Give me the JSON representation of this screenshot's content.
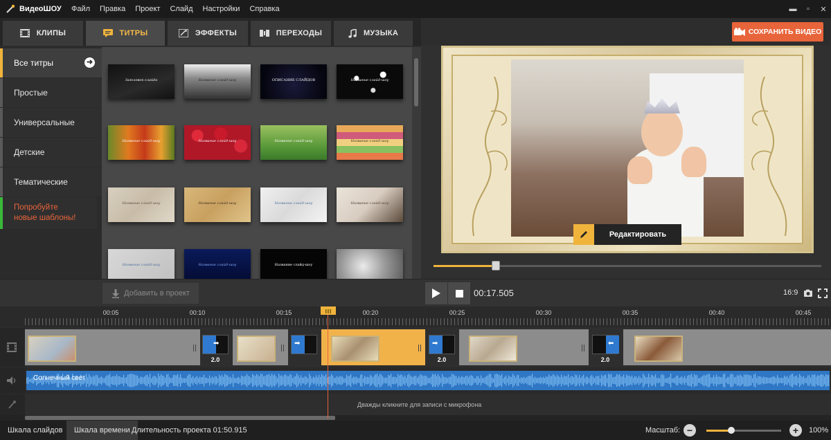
{
  "app": {
    "logo_text": "ВидеоШОУ"
  },
  "menu": {
    "items": [
      "Файл",
      "Правка",
      "Проект",
      "Слайд",
      "Настройки",
      "Справка"
    ]
  },
  "window_controls": {
    "minimize": "▬",
    "maximize": "▫",
    "close": "✕"
  },
  "tabs": [
    {
      "label": "КЛИПЫ",
      "icon": "film-icon"
    },
    {
      "label": "ТИТРЫ",
      "icon": "titles-icon",
      "active": true
    },
    {
      "label": "ЭФФЕКТЫ",
      "icon": "effects-icon"
    },
    {
      "label": "ПЕРЕХОДЫ",
      "icon": "transitions-icon"
    },
    {
      "label": "МУЗЫКА",
      "icon": "music-note-icon"
    }
  ],
  "save_button": {
    "label": "СОХРАНИТЬ ВИДЕО",
    "icon": "camera-icon",
    "color": "#e8643a"
  },
  "categories": [
    {
      "label": "Все титры",
      "active": true
    },
    {
      "label": "Простые"
    },
    {
      "label": "Универсальные"
    },
    {
      "label": "Детские"
    },
    {
      "label": "Тематические"
    },
    {
      "label": "Попробуйте новые шаблоны!",
      "promo": true
    }
  ],
  "thumbnails": [
    {
      "caption": "Заголовок слайда"
    },
    {
      "caption": "Название слайд-шоу"
    },
    {
      "caption": "ОПИСАНИЕ СЛАЙДОВ"
    },
    {
      "caption": "Название слайд-шоу"
    },
    {
      "caption": "Название слайд-шоу"
    },
    {
      "caption": "Название слайд-шоу"
    },
    {
      "caption": "Название слайд-шоу"
    },
    {
      "caption": "Название слайд-шоу"
    },
    {
      "caption": "Название слайд-шоу"
    },
    {
      "caption": "Название слайд-шоу"
    },
    {
      "caption": "Название слайд-шоу"
    },
    {
      "caption": "Название слайд-шоу"
    },
    {
      "caption": "Название слайд-шоу"
    },
    {
      "caption": "Название слайд-шоу"
    },
    {
      "caption": "Название слайд-шоу"
    },
    {
      "caption": ""
    }
  ],
  "preview": {
    "edit_button": "Редактировать",
    "progress": 0.16
  },
  "controls": {
    "add_to_project": "Добавить в проект",
    "timecode": "00:17.505",
    "aspect": "16:9"
  },
  "ruler": {
    "labels": [
      "00:05",
      "00:10",
      "00:15",
      "00:20",
      "00:25",
      "00:30",
      "00:35",
      "00:40",
      "00:45"
    ]
  },
  "timeline": {
    "transitions": [
      {
        "duration": "2.0"
      },
      {
        "duration": ""
      },
      {
        "duration": "2.0"
      },
      {
        "duration": "2.0"
      }
    ],
    "audio_label": "Солнечный свет",
    "mic_hint": "Дважды кликните для записи с микрофона"
  },
  "status": {
    "slides_tab": "Шкала слайдов",
    "timeline_tab": "Шкала времени",
    "duration": "Длительность проекта 01:50.915",
    "zoom_label": "Масштаб:",
    "zoom_value": "100%",
    "zoom_minus": "−",
    "zoom_plus": "+",
    "zoom_level": 0.33
  },
  "colors": {
    "accent": "#f0b43c",
    "brand_orange": "#e8643a",
    "audio_wave": "#2f77c4",
    "promo_green": "#3ab83a"
  }
}
